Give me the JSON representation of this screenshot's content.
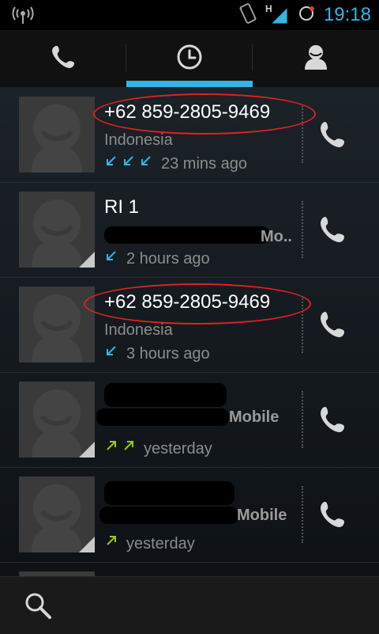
{
  "status": {
    "time": "19:18",
    "network_letter": "H"
  },
  "tabs": [
    {
      "name": "phone"
    },
    {
      "name": "recent"
    },
    {
      "name": "contacts"
    }
  ],
  "calls": [
    {
      "name": "+62 859-2805-9469",
      "location": "Indonesia",
      "time": "23 mins ago"
    },
    {
      "name": "RI 1",
      "location": "Mo..",
      "time": "2 hours ago"
    },
    {
      "name": "+62 859-2805-9469",
      "location": "Indonesia",
      "time": "3 hours ago"
    },
    {
      "name": "",
      "location": "Mobile",
      "time": "yesterday"
    },
    {
      "name": "",
      "location": "Mobile",
      "time": "yesterday"
    }
  ],
  "colors": {
    "accent": "#33b5e5",
    "incoming": "#33b5e5",
    "outgoing": "#99cc00",
    "annotation": "#dd2222"
  },
  "icons": {
    "search": "search-icon",
    "call": "phone-icon"
  }
}
